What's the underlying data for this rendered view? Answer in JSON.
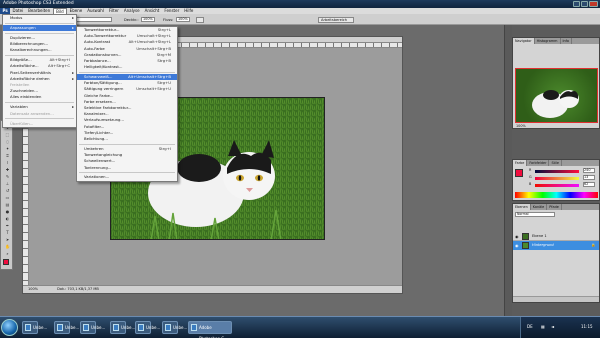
{
  "window": {
    "title": "Adobe Photoshop CS3 Extended"
  },
  "menubar": [
    "Datei",
    "Bearbeiten",
    "Bild",
    "Ebene",
    "Auswahl",
    "Filter",
    "Analyse",
    "Ansicht",
    "Fenster",
    "Hilfe"
  ],
  "optionsbar": {
    "zoom_label": "Deckkr.:",
    "zoom_value": "100%",
    "flow_label": "Fluss:",
    "flow_value": "100%",
    "workspace_button": "Arbeitsbereich"
  },
  "bild_menu": {
    "items": [
      {
        "label": "Modus",
        "shortcut": "",
        "submenu": true,
        "disabled": false,
        "highlighted": false
      },
      {
        "sep": true
      },
      {
        "label": "Anpassungen",
        "shortcut": "",
        "submenu": true,
        "disabled": false,
        "highlighted": true
      },
      {
        "sep": true
      },
      {
        "label": "Duplizieren...",
        "shortcut": "",
        "submenu": false,
        "disabled": false,
        "highlighted": false
      },
      {
        "label": "Bildberechnungen...",
        "shortcut": "",
        "submenu": false,
        "disabled": false,
        "highlighted": false
      },
      {
        "label": "Kanalberechnungen...",
        "shortcut": "",
        "submenu": false,
        "disabled": false,
        "highlighted": false
      },
      {
        "sep": true
      },
      {
        "label": "Bildgröße...",
        "shortcut": "Alt+Strg+I",
        "submenu": false,
        "disabled": false,
        "highlighted": false
      },
      {
        "label": "Arbeitsfläche...",
        "shortcut": "Alt+Strg+C",
        "submenu": false,
        "disabled": false,
        "highlighted": false
      },
      {
        "label": "Pixel-Seitenverhältnis",
        "shortcut": "",
        "submenu": true,
        "disabled": false,
        "highlighted": false
      },
      {
        "label": "Arbeitsfläche drehen",
        "shortcut": "",
        "submenu": true,
        "disabled": false,
        "highlighted": false
      },
      {
        "label": "Freistellen",
        "shortcut": "",
        "submenu": false,
        "disabled": true,
        "highlighted": false
      },
      {
        "label": "Zuschneiden...",
        "shortcut": "",
        "submenu": false,
        "disabled": false,
        "highlighted": false
      },
      {
        "label": "Alles einblenden",
        "shortcut": "",
        "submenu": false,
        "disabled": false,
        "highlighted": false
      },
      {
        "sep": true
      },
      {
        "label": "Variablen",
        "shortcut": "",
        "submenu": true,
        "disabled": false,
        "highlighted": false
      },
      {
        "label": "Datensatz anwenden...",
        "shortcut": "",
        "submenu": false,
        "disabled": true,
        "highlighted": false
      },
      {
        "sep": true
      },
      {
        "label": "Überfüllen...",
        "shortcut": "",
        "submenu": false,
        "disabled": true,
        "highlighted": false
      }
    ]
  },
  "adjust_menu": {
    "items": [
      {
        "label": "Tonwertkorrektur...",
        "shortcut": "Strg+L"
      },
      {
        "label": "Auto-Tonwertkorrektur",
        "shortcut": "Umschalt+Strg+L"
      },
      {
        "label": "Auto-Kontrast",
        "shortcut": "Alt+Umschalt+Strg+L"
      },
      {
        "label": "Auto-Farbe",
        "shortcut": "Umschalt+Strg+B"
      },
      {
        "label": "Gradationskurven...",
        "shortcut": "Strg+M"
      },
      {
        "label": "Farbbalance...",
        "shortcut": "Strg+B"
      },
      {
        "label": "Helligkeit/Kontrast...",
        "shortcut": ""
      },
      {
        "sep": true
      },
      {
        "label": "Schwarzweiß...",
        "shortcut": "Alt+Umschalt+Strg+B",
        "highlighted": true
      },
      {
        "label": "Farbton/Sättigung...",
        "shortcut": "Strg+U"
      },
      {
        "label": "Sättigung verringern",
        "shortcut": "Umschalt+Strg+U"
      },
      {
        "label": "Gleiche Farbe...",
        "shortcut": ""
      },
      {
        "label": "Farbe ersetzen...",
        "shortcut": ""
      },
      {
        "label": "Selektive Farbkorrektur...",
        "shortcut": ""
      },
      {
        "label": "Kanalmixer...",
        "shortcut": ""
      },
      {
        "label": "Verlaufsumsetzung...",
        "shortcut": ""
      },
      {
        "label": "Fotofilter...",
        "shortcut": ""
      },
      {
        "label": "Tiefen/Lichter...",
        "shortcut": ""
      },
      {
        "label": "Belichtung...",
        "shortcut": ""
      },
      {
        "sep": true
      },
      {
        "label": "Umkehren",
        "shortcut": "Strg+I"
      },
      {
        "label": "Tonwertangleichung",
        "shortcut": ""
      },
      {
        "label": "Schwellenwert...",
        "shortcut": ""
      },
      {
        "label": "Tontrennung...",
        "shortcut": ""
      },
      {
        "sep": true
      },
      {
        "label": "Variationen...",
        "shortcut": ""
      }
    ]
  },
  "document": {
    "title": "",
    "status_zoom": "100%",
    "status_info": "Dok.: 703,1 KB/1,37 MB"
  },
  "panels": {
    "navigator_tabs": [
      "Navigator",
      "Histogramm",
      "Info"
    ],
    "navigator_zoom": "100%",
    "color_tabs": [
      "Farbe",
      "Farbfelder",
      "Stile"
    ],
    "color_values": [
      {
        "label": "R",
        "value": "240"
      },
      {
        "label": "G",
        "value": "13"
      },
      {
        "label": "B",
        "value": "62"
      }
    ],
    "layer_tabs": [
      "Ebenen",
      "Kanäle",
      "Pfade"
    ],
    "blend_mode": "Normal",
    "layers": [
      {
        "name": "Ebene 1",
        "selected": false
      },
      {
        "name": "Hintergrund",
        "selected": true
      }
    ],
    "fg_color": "#f00d3e",
    "bg_color": "#ffffff"
  },
  "taskbar": {
    "tasks": [
      "Unbe...",
      "Unbe...",
      "Unbe...",
      "Unbe...",
      "Unbe...",
      "Unbe...",
      "Adobe Photoshop C..."
    ],
    "locale": "DE",
    "time": "11:15"
  }
}
